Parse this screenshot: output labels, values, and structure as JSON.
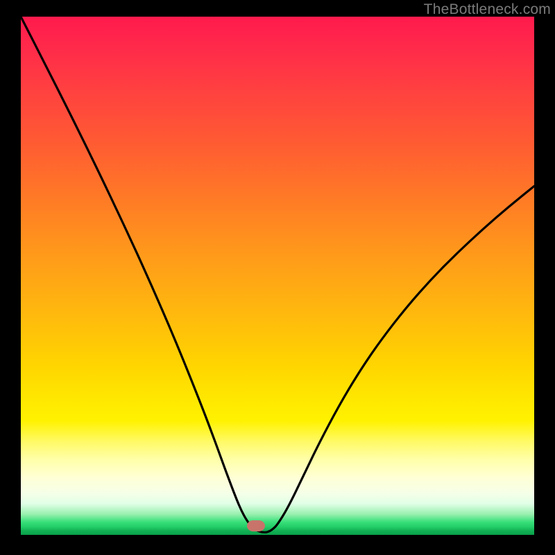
{
  "watermark": "TheBottleneck.com",
  "marker": {
    "x_pct": 45.8,
    "y_pct": 98.2
  },
  "chart_data": {
    "type": "line",
    "title": "",
    "xlabel": "",
    "ylabel": "",
    "ylim": [
      0,
      100
    ],
    "series": [
      {
        "name": "curve",
        "x": [
          0,
          5,
          10,
          15,
          20,
          25,
          30,
          35,
          38,
          40,
          42,
          43,
          44,
          45,
          46,
          47,
          48,
          49,
          50,
          52,
          55,
          58,
          62,
          66,
          70,
          75,
          80,
          85,
          90,
          95,
          100
        ],
        "y": [
          100,
          90.3,
          80.5,
          70.4,
          60.0,
          49.2,
          37.8,
          25.5,
          17.6,
          12.1,
          6.9,
          4.6,
          2.8,
          1.5,
          0.8,
          0.5,
          0.5,
          1.0,
          2.0,
          5.2,
          11.3,
          17.5,
          25.0,
          31.6,
          37.4,
          43.8,
          49.4,
          54.4,
          59.0,
          63.3,
          67.3
        ]
      }
    ],
    "background_gradient": {
      "top": "#ff1a4d",
      "mid": "#ffd400",
      "bottom": "#0aa04a"
    }
  }
}
